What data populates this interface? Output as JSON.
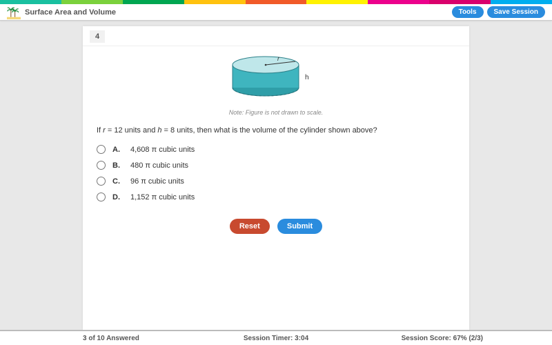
{
  "colorbar": [
    "#19c0a0",
    "#7bd13c",
    "#00a651",
    "#ffc20e",
    "#f15a29",
    "#fff200",
    "#ec008c",
    "#d9006c",
    "#00aeef"
  ],
  "header": {
    "title": "Surface Area and Volume",
    "tools_label": "Tools",
    "save_label": "Save Session"
  },
  "question": {
    "number": "4",
    "figure_note": "Note: Figure is not drawn to scale.",
    "r_label": "r",
    "h_label": "h",
    "prompt_prefix": "If ",
    "prompt_r": "r",
    "prompt_mid1": " = 12 units and ",
    "prompt_h": "h",
    "prompt_mid2": " = 8 units, then what is the volume of the cylinder shown above?",
    "choices": [
      {
        "letter": "A.",
        "text": "4,608 π  cubic units"
      },
      {
        "letter": "B.",
        "text": "480 π  cubic units"
      },
      {
        "letter": "C.",
        "text": "96 π  cubic units"
      },
      {
        "letter": "D.",
        "text": "1,152 π  cubic units"
      }
    ],
    "reset_label": "Reset",
    "submit_label": "Submit"
  },
  "footer": {
    "answered": "3 of 10 Answered",
    "timer": "Session Timer: 3:04",
    "score": "Session Score: 67% (2/3)"
  }
}
